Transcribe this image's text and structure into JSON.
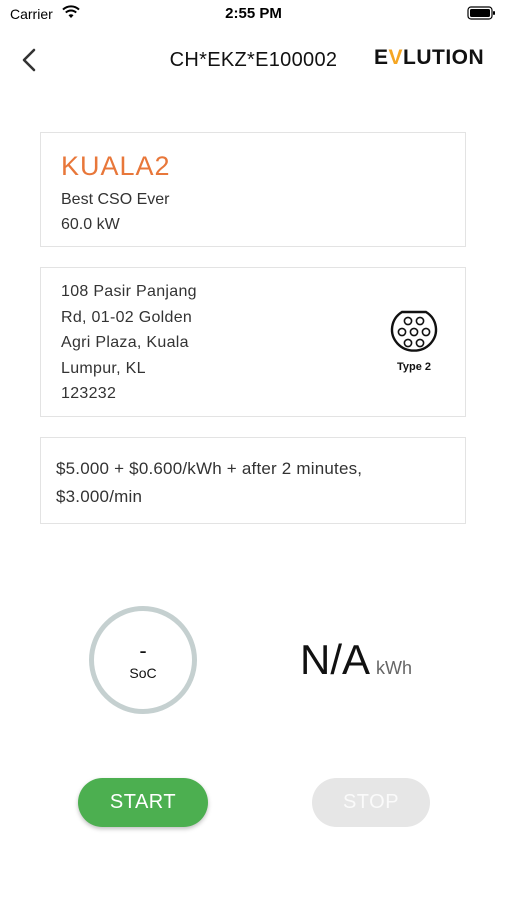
{
  "status_bar": {
    "carrier": "Carrier",
    "time": "2:55 PM"
  },
  "nav": {
    "title": "CH*EKZ*E100002",
    "logo": {
      "prefix": "E",
      "bolt": "V",
      "suffix": "LUTION"
    }
  },
  "station": {
    "name": "KUALA2",
    "operator": "Best CSO Ever",
    "power": "60.0 kW"
  },
  "location": {
    "address_lines": [
      "108 Pasir Panjang",
      "Rd, 01-02 Golden",
      "Agri Plaza, Kuala",
      "Lumpur, KL",
      "123232"
    ],
    "connector": {
      "label": "Type 2",
      "icon": "type2-connector-icon"
    }
  },
  "tariff": {
    "lines": [
      "$5.000 + $0.600/kWh + after 2 minutes,",
      "$3.000/min"
    ]
  },
  "session": {
    "soc_value": "-",
    "soc_label": "SoC",
    "energy_value": "N/A",
    "energy_unit": "kWh"
  },
  "actions": {
    "start_label": "START",
    "stop_label": "STOP"
  },
  "colors": {
    "accent_orange": "#e8773a",
    "start_green": "#4caf50",
    "stop_disabled": "#e6e6e6",
    "soc_ring": "#c5d0d0"
  }
}
